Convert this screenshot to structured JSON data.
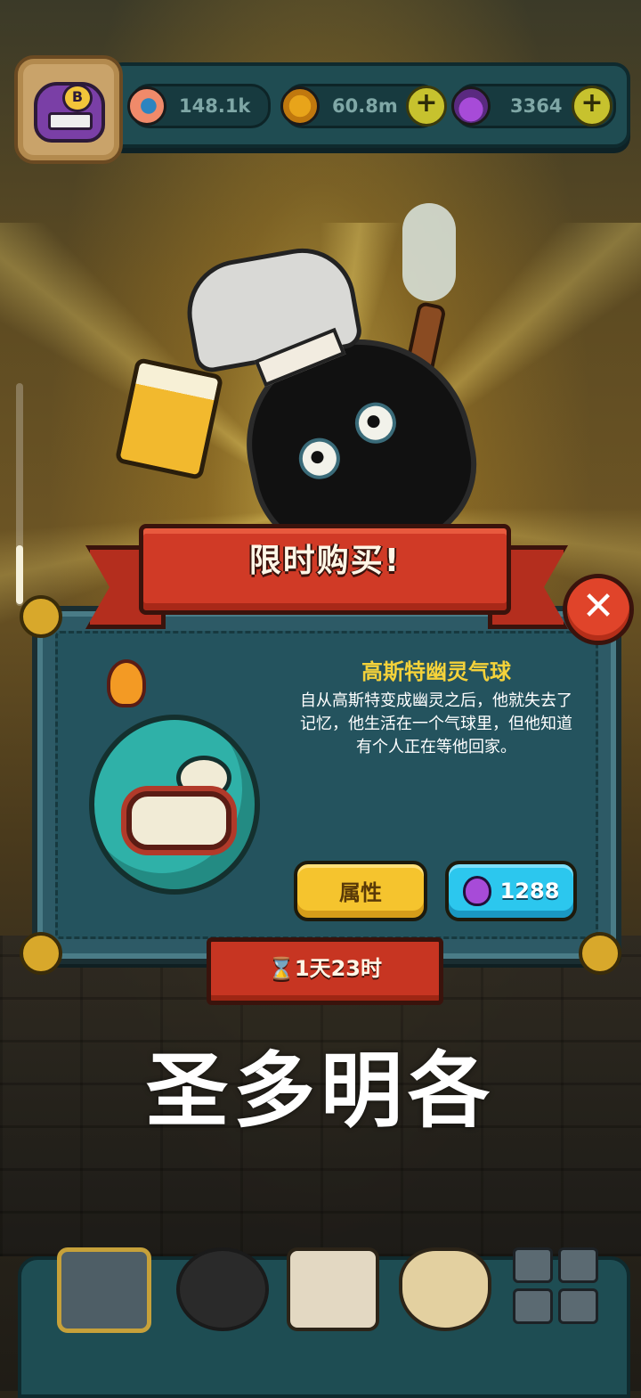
{
  "resources": {
    "eyes": "148.1k",
    "coins": "60.8m",
    "potions": "3364"
  },
  "offer": {
    "banner_title": "限时购买!",
    "item_name": "高斯特幽灵气球",
    "item_description": "自从高斯特变成幽灵之后，他就失去了记忆，他生活在一个气球里，但他知道有个人正在等他回家。",
    "attributes_button": "属性",
    "price": "1288",
    "timer": "⌛1天23时",
    "close_symbol": "✕"
  },
  "caption": "圣多明各",
  "plus_symbol": "+",
  "colors": {
    "ribbon": "#d03a26",
    "panel": "#2d5a66",
    "item_name": "#f4d23a",
    "attributes_button": "#f5c42e",
    "buy_button": "#2cc7ee"
  },
  "icons": [
    "eye-icon",
    "coin-icon",
    "potion-icon",
    "close-icon",
    "hourglass-icon",
    "building-icon",
    "monster-icon",
    "book-icon",
    "bag-icon",
    "grid-icon"
  ]
}
